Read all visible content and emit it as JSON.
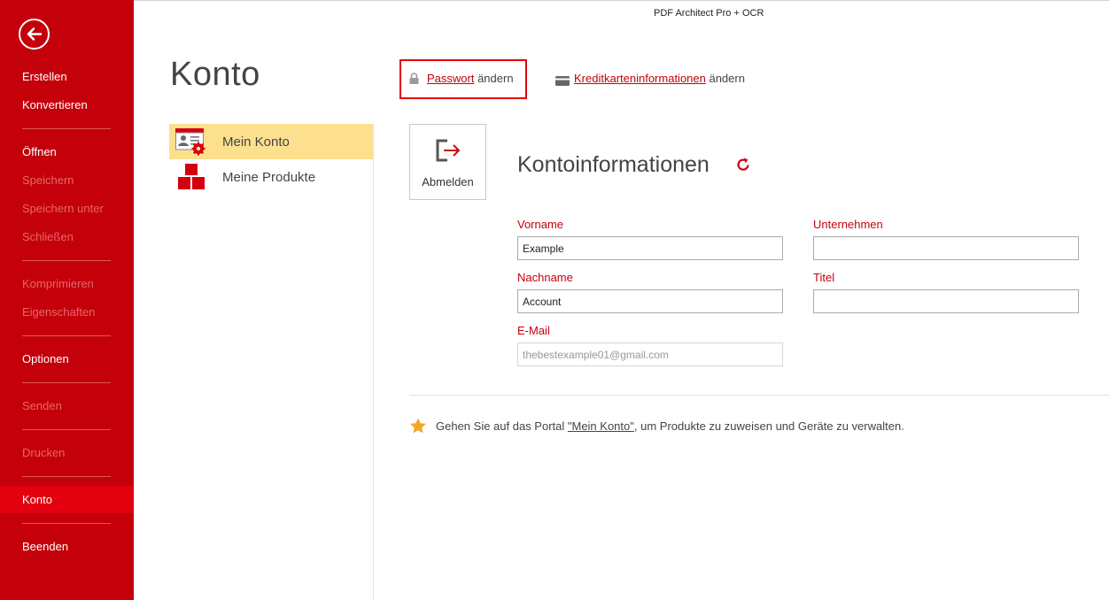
{
  "app": {
    "title": "PDF Architect Pro + OCR"
  },
  "sidebar": {
    "items": [
      {
        "label": "Erstellen",
        "state": "normal"
      },
      {
        "label": "Konvertieren",
        "state": "normal"
      },
      {
        "label": "Öffnen",
        "state": "normal"
      },
      {
        "label": "Speichern",
        "state": "disabled"
      },
      {
        "label": "Speichern unter",
        "state": "disabled"
      },
      {
        "label": "Schließen",
        "state": "disabled"
      },
      {
        "label": "Komprimieren",
        "state": "disabled"
      },
      {
        "label": "Eigenschaften",
        "state": "disabled"
      },
      {
        "label": "Optionen",
        "state": "normal"
      },
      {
        "label": "Senden",
        "state": "disabled"
      },
      {
        "label": "Drucken",
        "state": "disabled"
      },
      {
        "label": "Konto",
        "state": "active"
      },
      {
        "label": "Beenden",
        "state": "normal"
      }
    ]
  },
  "page": {
    "title": "Konto"
  },
  "account_menu": {
    "items": [
      {
        "label": "Mein Konto",
        "selected": true
      },
      {
        "label": "Meine Produkte",
        "selected": false
      }
    ]
  },
  "header_links": {
    "password_link": "Passwort",
    "password_suffix": " ändern",
    "card_link": "Kreditkarteninformationen",
    "card_suffix": " ändern"
  },
  "logout": {
    "label": "Abmelden"
  },
  "account_info": {
    "title": "Kontoinformationen",
    "fields": {
      "vorname": {
        "label": "Vorname",
        "value": "Example"
      },
      "nachname": {
        "label": "Nachname",
        "value": "Account"
      },
      "email": {
        "label": "E-Mail",
        "value": "thebestexample01@gmail.com"
      },
      "unternehmen": {
        "label": "Unternehmen",
        "value": ""
      },
      "titel": {
        "label": "Titel",
        "value": ""
      }
    }
  },
  "footer_note": {
    "prefix": "Gehen Sie auf das Portal ",
    "link": "\"Mein Konto\"",
    "suffix": ", um Produkte zu zuweisen und Geräte zu verwalten."
  },
  "colors": {
    "sidebar": "#c4000a",
    "active": "#e3000f",
    "selected_row": "#fde08e",
    "accent": "#c4000a",
    "star": "#f5a623"
  }
}
